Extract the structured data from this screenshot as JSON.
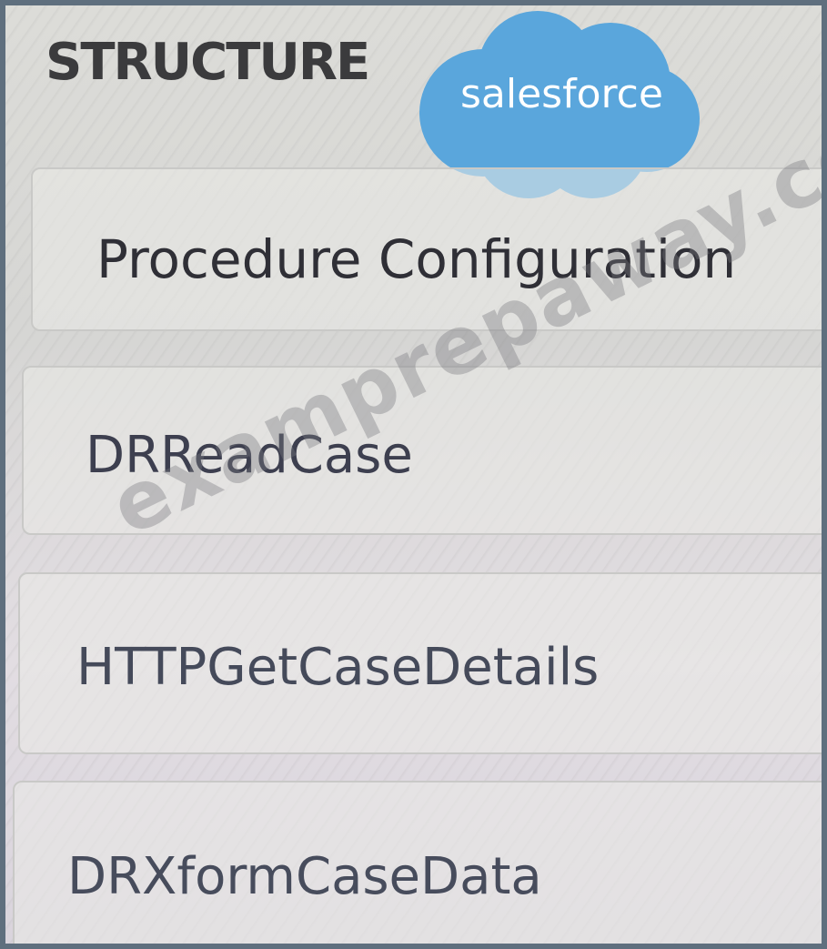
{
  "structure_heading": "STRUCTURE",
  "logo": {
    "text": "salesforce",
    "color": "#5aa6dc"
  },
  "steps": [
    {
      "label": "Procedure Configuration"
    },
    {
      "label": "DRReadCase"
    },
    {
      "label": "HTTPGetCaseDetails"
    },
    {
      "label": "DRXformCaseData"
    }
  ],
  "watermark": "examprepaway.com"
}
